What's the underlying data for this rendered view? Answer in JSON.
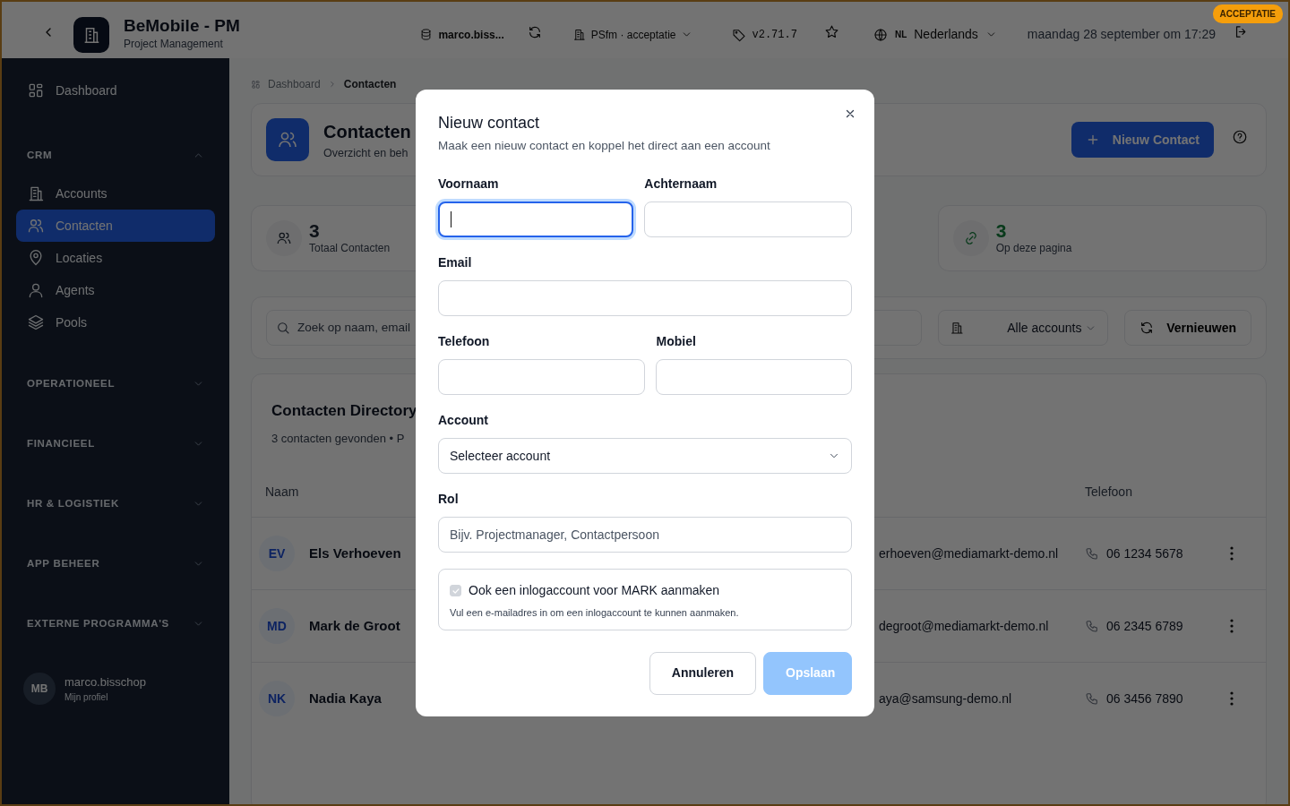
{
  "app_bar": {
    "title": "BeMobile - PM",
    "subtitle": "Project Management",
    "user": "marco.biss...",
    "environment": "PSfm · acceptatie",
    "version": "v2.71.7",
    "language_code": "NL",
    "language": "Nederlands",
    "datetime": "maandag 28 september om 17:29",
    "badge": "ACCEPTATIE"
  },
  "sidebar": {
    "items": [
      {
        "label": "Dashboard",
        "selected": false
      }
    ],
    "sections": [
      {
        "label": "CRM",
        "expanded": true,
        "items": [
          {
            "label": "Accounts",
            "selected": false
          },
          {
            "label": "Contacten",
            "selected": true
          },
          {
            "label": "Locaties",
            "selected": false
          },
          {
            "label": "Agents",
            "selected": false
          },
          {
            "label": "Pools",
            "selected": false
          }
        ]
      },
      {
        "label": "OPERATIONEEL",
        "expanded": false
      },
      {
        "label": "FINANCIEEL",
        "expanded": false
      },
      {
        "label": "HR & LOGISTIEK",
        "expanded": false
      },
      {
        "label": "APP BEHEER",
        "expanded": false
      },
      {
        "label": "EXTERNE PROGRAMMA'S",
        "expanded": false
      }
    ],
    "user": {
      "initials": "MB",
      "name": "marco.bisschop",
      "subtitle": "Mijn profiel"
    }
  },
  "breadcrumb": [
    {
      "label": "Dashboard"
    },
    {
      "label": "Contacten"
    }
  ],
  "page_header": {
    "title": "Contacten",
    "subtitle": "Overzicht en beh",
    "button": "Nieuw Contact"
  },
  "stats": [
    {
      "value": "3",
      "label": "Totaal Contacten"
    },
    {
      "value": "3",
      "label": "Op deze pagina"
    }
  ],
  "filters": {
    "search_placeholder": "Zoek op naam, email",
    "account_filter": "Alle accounts",
    "refresh": "Vernieuwen"
  },
  "directory": {
    "title": "Contacten Directory",
    "subtitle": "3 contacten gevonden • P",
    "columns": [
      "Naam",
      "Telefoon"
    ],
    "rows": [
      {
        "initials": "EV",
        "name": "Els Verhoeven",
        "email": "erhoeven@mediamarkt-demo.nl",
        "phone": "06 1234 5678"
      },
      {
        "initials": "MD",
        "name": "Mark de Groot",
        "email": "degroot@mediamarkt-demo.nl",
        "phone": "06 2345 6789"
      },
      {
        "initials": "NK",
        "name": "Nadia Kaya",
        "email": "aya@samsung-demo.nl",
        "phone": "06 3456 7890"
      }
    ]
  },
  "modal": {
    "title": "Nieuw contact",
    "subtitle": "Maak een nieuw contact en koppel het direct aan een account",
    "rows": [
      [
        {
          "label": "Voornaam",
          "kind": "text",
          "focused": true
        },
        {
          "label": "Achternaam",
          "kind": "text",
          "focused": false
        }
      ],
      [
        {
          "label": "Email",
          "kind": "text",
          "focused": false
        }
      ],
      [
        {
          "label": "Telefoon",
          "kind": "text",
          "focused": false
        },
        {
          "label": "Mobiel",
          "kind": "text",
          "focused": false
        }
      ],
      [
        {
          "label": "Account",
          "kind": "select",
          "value": "Selecteer account",
          "focused": false
        }
      ],
      [
        {
          "label": "Rol",
          "kind": "text",
          "placeholder": "Bijv. Projectmanager, Contactpersoon",
          "focused": false
        }
      ]
    ],
    "checkbox": {
      "label": "Ook een inlogaccount voor MARK aanmaken",
      "hint": "Vul een e-mailadres in om een inlogaccount te kunnen aanmaken.",
      "checked": true,
      "disabled": true
    },
    "buttons": [
      {
        "label": "Annuleren",
        "kind": "secondary",
        "disabled": false
      },
      {
        "label": "Opslaan",
        "kind": "primary",
        "disabled": true
      }
    ]
  }
}
